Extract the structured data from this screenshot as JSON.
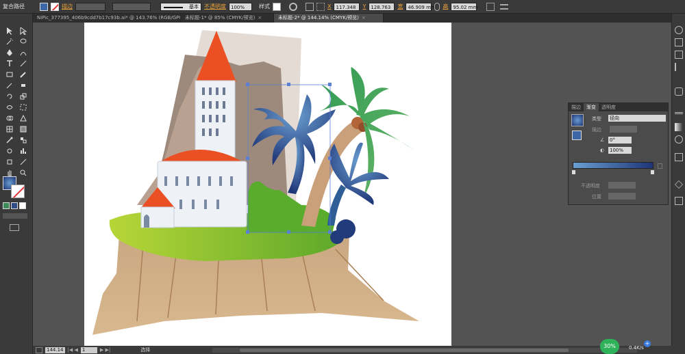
{
  "control_bar": {
    "mode_label": "复合路径",
    "stroke_label": "描边",
    "brush_label": "基本",
    "opacity_label": "不透明度",
    "opacity_value": "100%",
    "style_label": "样式",
    "x_label": "X",
    "x_value": "117.348",
    "y_label": "Y",
    "y_value": "128.763",
    "w_label": "宽",
    "w_value": "46.909 mm",
    "h_label": "高",
    "h_value": "95.02 mm"
  },
  "tabs": [
    {
      "label": "NiPic_377395_406b9cdd7b17c93b.ai* @ 143.76% (RGB/GPU 预览)",
      "active": false
    },
    {
      "label": "未标题-1* @ 85% (CMYK/预览)",
      "active": false
    },
    {
      "label": "未标题-2* @ 144.14% (CMYK/预览)",
      "active": true
    }
  ],
  "gradient_panel": {
    "tabs": [
      "描边",
      "渐变",
      "透明度"
    ],
    "type_label": "类型",
    "type_value": "径向",
    "stroke_label": "描边",
    "angle_value": "0°",
    "aspect_value": "100%",
    "opacity_label": "不透明度",
    "position_label": "位置",
    "gradient_start": "#6a9ed0",
    "gradient_end": "#1e3576"
  },
  "status_bar": {
    "zoom": "144.14",
    "page": "1",
    "tool": "选择",
    "net_percent": "30%",
    "net_speed": "0.4K/s"
  },
  "colors": {
    "fill_swatch": "#3d66a7",
    "selection": "#5b7fd4"
  },
  "icons": [
    "selection-tool-icon",
    "direct-selection-tool-icon",
    "pen-tool-icon",
    "type-tool-icon",
    "brush-tool-icon",
    "hand-tool-icon",
    "zoom-tool-icon"
  ]
}
